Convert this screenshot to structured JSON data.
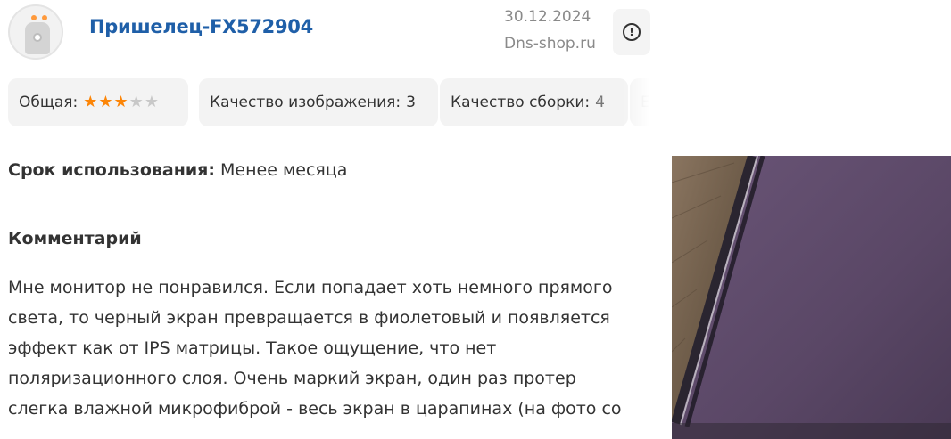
{
  "review": {
    "author": "Пришелец-FX572904",
    "date": "30.12.2024",
    "source": "Dns-shop.ru",
    "report_icon": "exclamation-icon"
  },
  "ratings": {
    "overall_label": "Общая:",
    "overall_stars": 3,
    "overall_max": 5,
    "image_quality_label": "Качество изображения:",
    "image_quality_value": "3",
    "build_quality_label": "Качество сборки:",
    "build_quality_value": "4",
    "next_chip_partial": "E"
  },
  "usage": {
    "label": "Срок использования:",
    "value": "Менее месяца"
  },
  "comment": {
    "title": "Комментарий",
    "lines": [
      "Мне монитор не понравился. Если попадает хоть немного прямого",
      "света, то черный экран превращается в фиолетовый и появляется",
      "эффект как от IPS матрицы. Такое ощущение, что нет",
      "поляризационного слоя. Очень маркий экран, один раз протер",
      "слегка влажной микрофиброй - весь экран в царапинах (на фото со"
    ]
  },
  "colors": {
    "author_link": "#1f5fa8",
    "star_active": "#fc8507",
    "star_inactive": "#c8c8c8",
    "chip_bg": "#f3f3f3"
  }
}
